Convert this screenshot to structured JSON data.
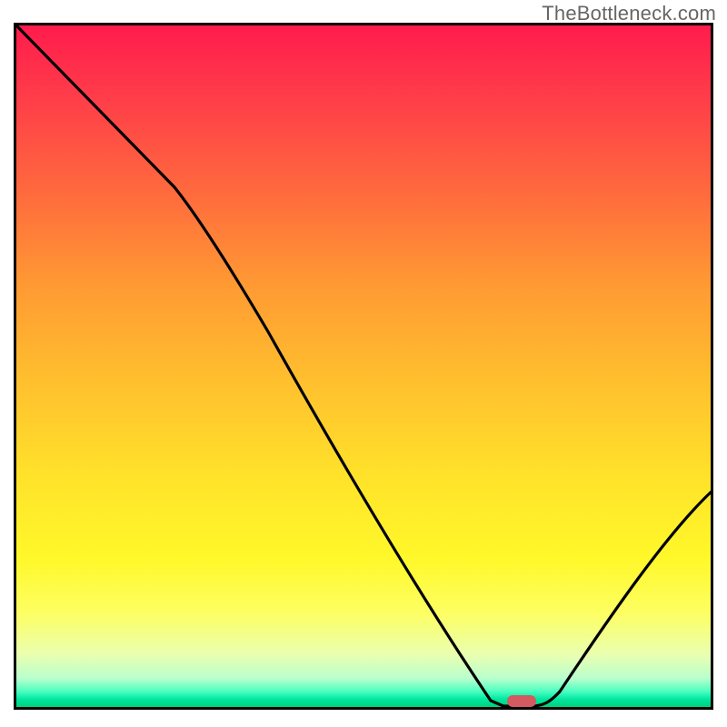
{
  "watermark": "TheBottleneck.com",
  "chart_data": {
    "type": "line",
    "title": "",
    "xlabel": "",
    "ylabel": "",
    "xlim": [
      0,
      100
    ],
    "ylim": [
      0,
      100
    ],
    "x": [
      0,
      23,
      70,
      74,
      78,
      100
    ],
    "values": [
      100,
      76,
      0,
      0,
      0.5,
      32
    ],
    "annotations": [
      {
        "type": "marker",
        "x": 73,
        "y": 0.2,
        "color": "#d25a60",
        "shape": "pill"
      }
    ],
    "background": "vertical-gradient red→green",
    "grid": false
  },
  "colors": {
    "curve": "#000000",
    "frame": "#000000",
    "marker": "#d25a60",
    "watermark": "#666666"
  }
}
